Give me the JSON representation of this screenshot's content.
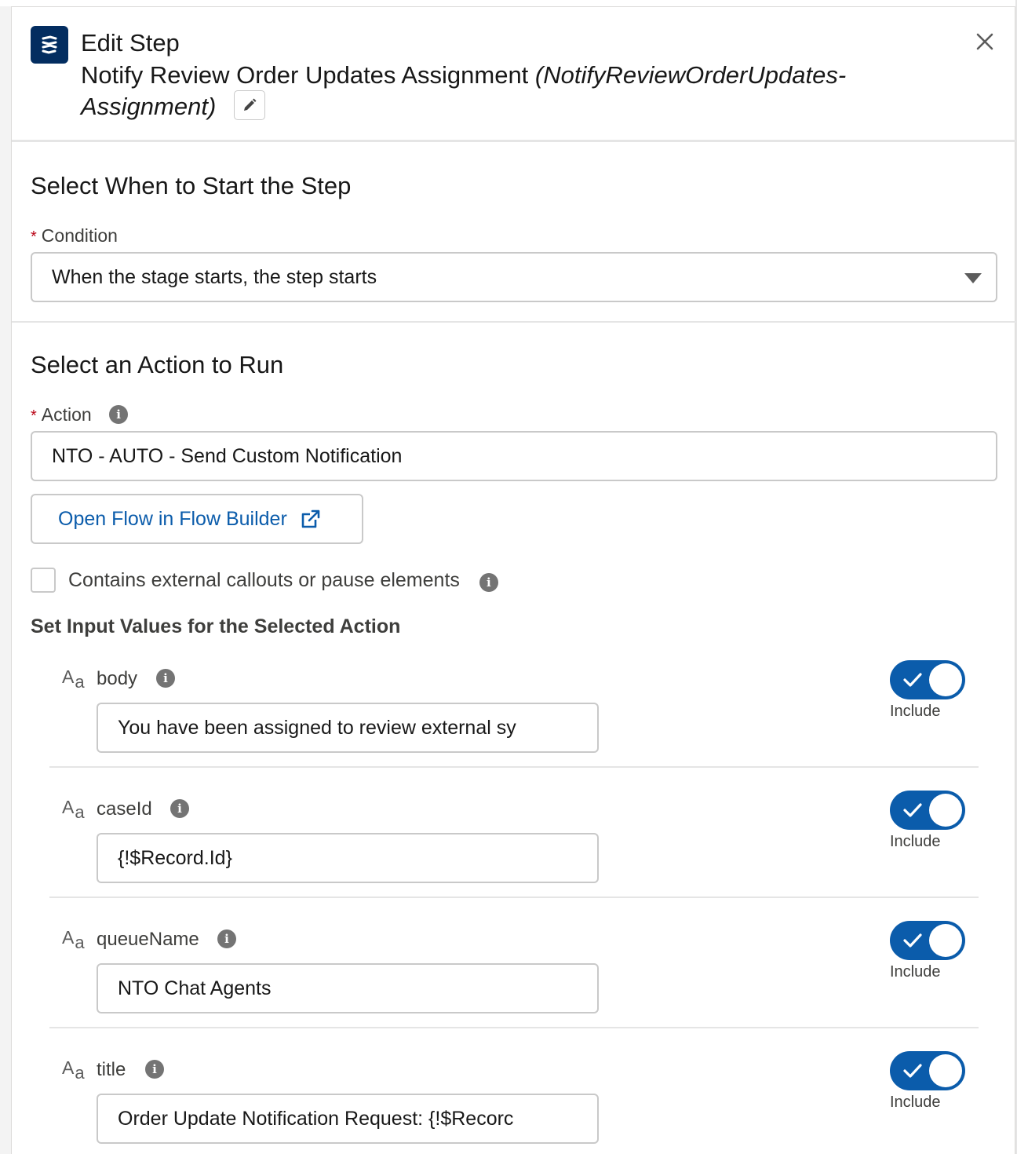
{
  "header": {
    "title": "Edit Step",
    "step_label": "Notify Review Order Updates Assignment",
    "api_name": "(NotifyReviewOrderUpdates-Assignment)",
    "app_icon": "orchestrator-icon",
    "edit_icon": "pencil-icon",
    "close_icon": "close-icon"
  },
  "start": {
    "section_title": "Select When to Start the Step",
    "condition_label": "Condition",
    "condition_value": "When the stage starts, the step starts"
  },
  "action": {
    "section_title": "Select an Action to Run",
    "action_label": "Action",
    "action_value": "NTO - AUTO - Send Custom Notification",
    "open_flow_label": "Open Flow in Flow Builder",
    "callouts_label": "Contains external callouts or pause elements",
    "callouts_checked": false,
    "inputs_heading": "Set Input Values for the Selected Action"
  },
  "inputs": [
    {
      "name": "body",
      "value": "You have been assigned to review external sy",
      "include": true,
      "include_label": "Include"
    },
    {
      "name": "caseId",
      "value": "{!$Record.Id}",
      "include": true,
      "include_label": "Include"
    },
    {
      "name": "queueName",
      "value": "NTO Chat Agents",
      "include": true,
      "include_label": "Include"
    },
    {
      "name": "title",
      "value": "Order Update Notification Request: {!$Recorc",
      "include": true,
      "include_label": "Include"
    }
  ],
  "colors": {
    "brand": "#0b5cab",
    "icon_bg": "#032d60",
    "required": "#ba0517"
  }
}
